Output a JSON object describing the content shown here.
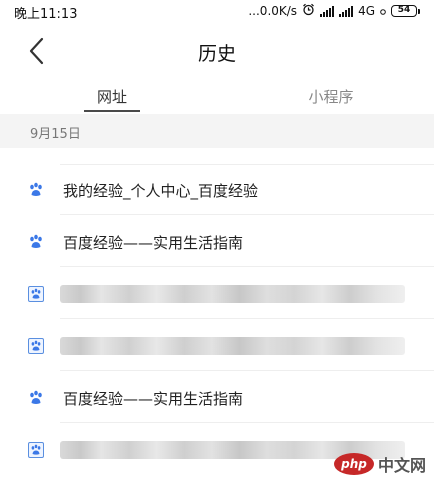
{
  "status_bar": {
    "time": "晚上11:13",
    "network_speed": "...0.0K/s",
    "network_type": "4G",
    "battery": "54"
  },
  "header": {
    "title": "历史"
  },
  "tabs": [
    {
      "label": "网址",
      "active": true
    },
    {
      "label": "小程序",
      "active": false
    }
  ],
  "date_label": "9月15日",
  "history_items": [
    {
      "icon": "baidu-paw-icon",
      "title": "我的经验_个人中心_百度经验",
      "blurred": false
    },
    {
      "icon": "baidu-paw-icon",
      "title": "百度经验——实用生活指南",
      "blurred": false
    },
    {
      "icon": "baidu-paw-boxed-icon",
      "title": "",
      "blurred": true
    },
    {
      "icon": "baidu-paw-boxed-icon",
      "title": "",
      "blurred": true
    },
    {
      "icon": "baidu-paw-icon",
      "title": "百度经验——实用生活指南",
      "blurred": false
    },
    {
      "icon": "baidu-paw-boxed-icon",
      "title": "",
      "blurred": true
    }
  ],
  "watermark": {
    "logo_text": "php",
    "site_text": "中文网"
  },
  "colors": {
    "accent_blue": "#3b78e7",
    "tab_inactive": "#888888",
    "date_bg": "#f4f4f4"
  }
}
